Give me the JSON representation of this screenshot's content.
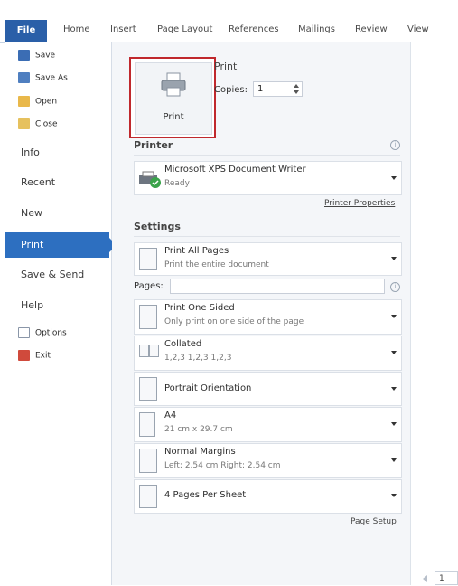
{
  "tabs": {
    "file": "File",
    "home": "Home",
    "insert": "Insert",
    "page_layout": "Page Layout",
    "references": "References",
    "mailings": "Mailings",
    "review": "Review",
    "view": "View"
  },
  "backstage": {
    "save": "Save",
    "save_as": "Save As",
    "open": "Open",
    "close": "Close",
    "info": "Info",
    "recent": "Recent",
    "new": "New",
    "print": "Print",
    "save_send": "Save & Send",
    "help": "Help",
    "options": "Options",
    "exit": "Exit"
  },
  "print": {
    "header": "Print",
    "button_label": "Print",
    "copies_label": "Copies:",
    "copies_value": "1"
  },
  "printer": {
    "header": "Printer",
    "name": "Microsoft XPS Document Writer",
    "status": "Ready",
    "properties_link": "Printer Properties"
  },
  "settings": {
    "header": "Settings",
    "pages_label": "Pages:",
    "pages_value": "",
    "range_title": "Print All Pages",
    "range_desc": "Print the entire document",
    "sides_title": "Print One Sided",
    "sides_desc": "Only print on one side of the page",
    "collate_title": "Collated",
    "collate_desc": "1,2,3   1,2,3   1,2,3",
    "orientation": "Portrait Orientation",
    "paper_title": "A4",
    "paper_desc": "21 cm x 29.7 cm",
    "margins_title": "Normal Margins",
    "margins_desc": "Left:  2.54 cm    Right:  2.54 cm",
    "per_sheet": "4 Pages Per Sheet",
    "page_setup_link": "Page Setup"
  },
  "preview": {
    "page_number": "1"
  },
  "colors": {
    "file_tab": "#2a5fa8",
    "selected_nav": "#2d6fc0",
    "print_btn_border": "#c0282d"
  }
}
